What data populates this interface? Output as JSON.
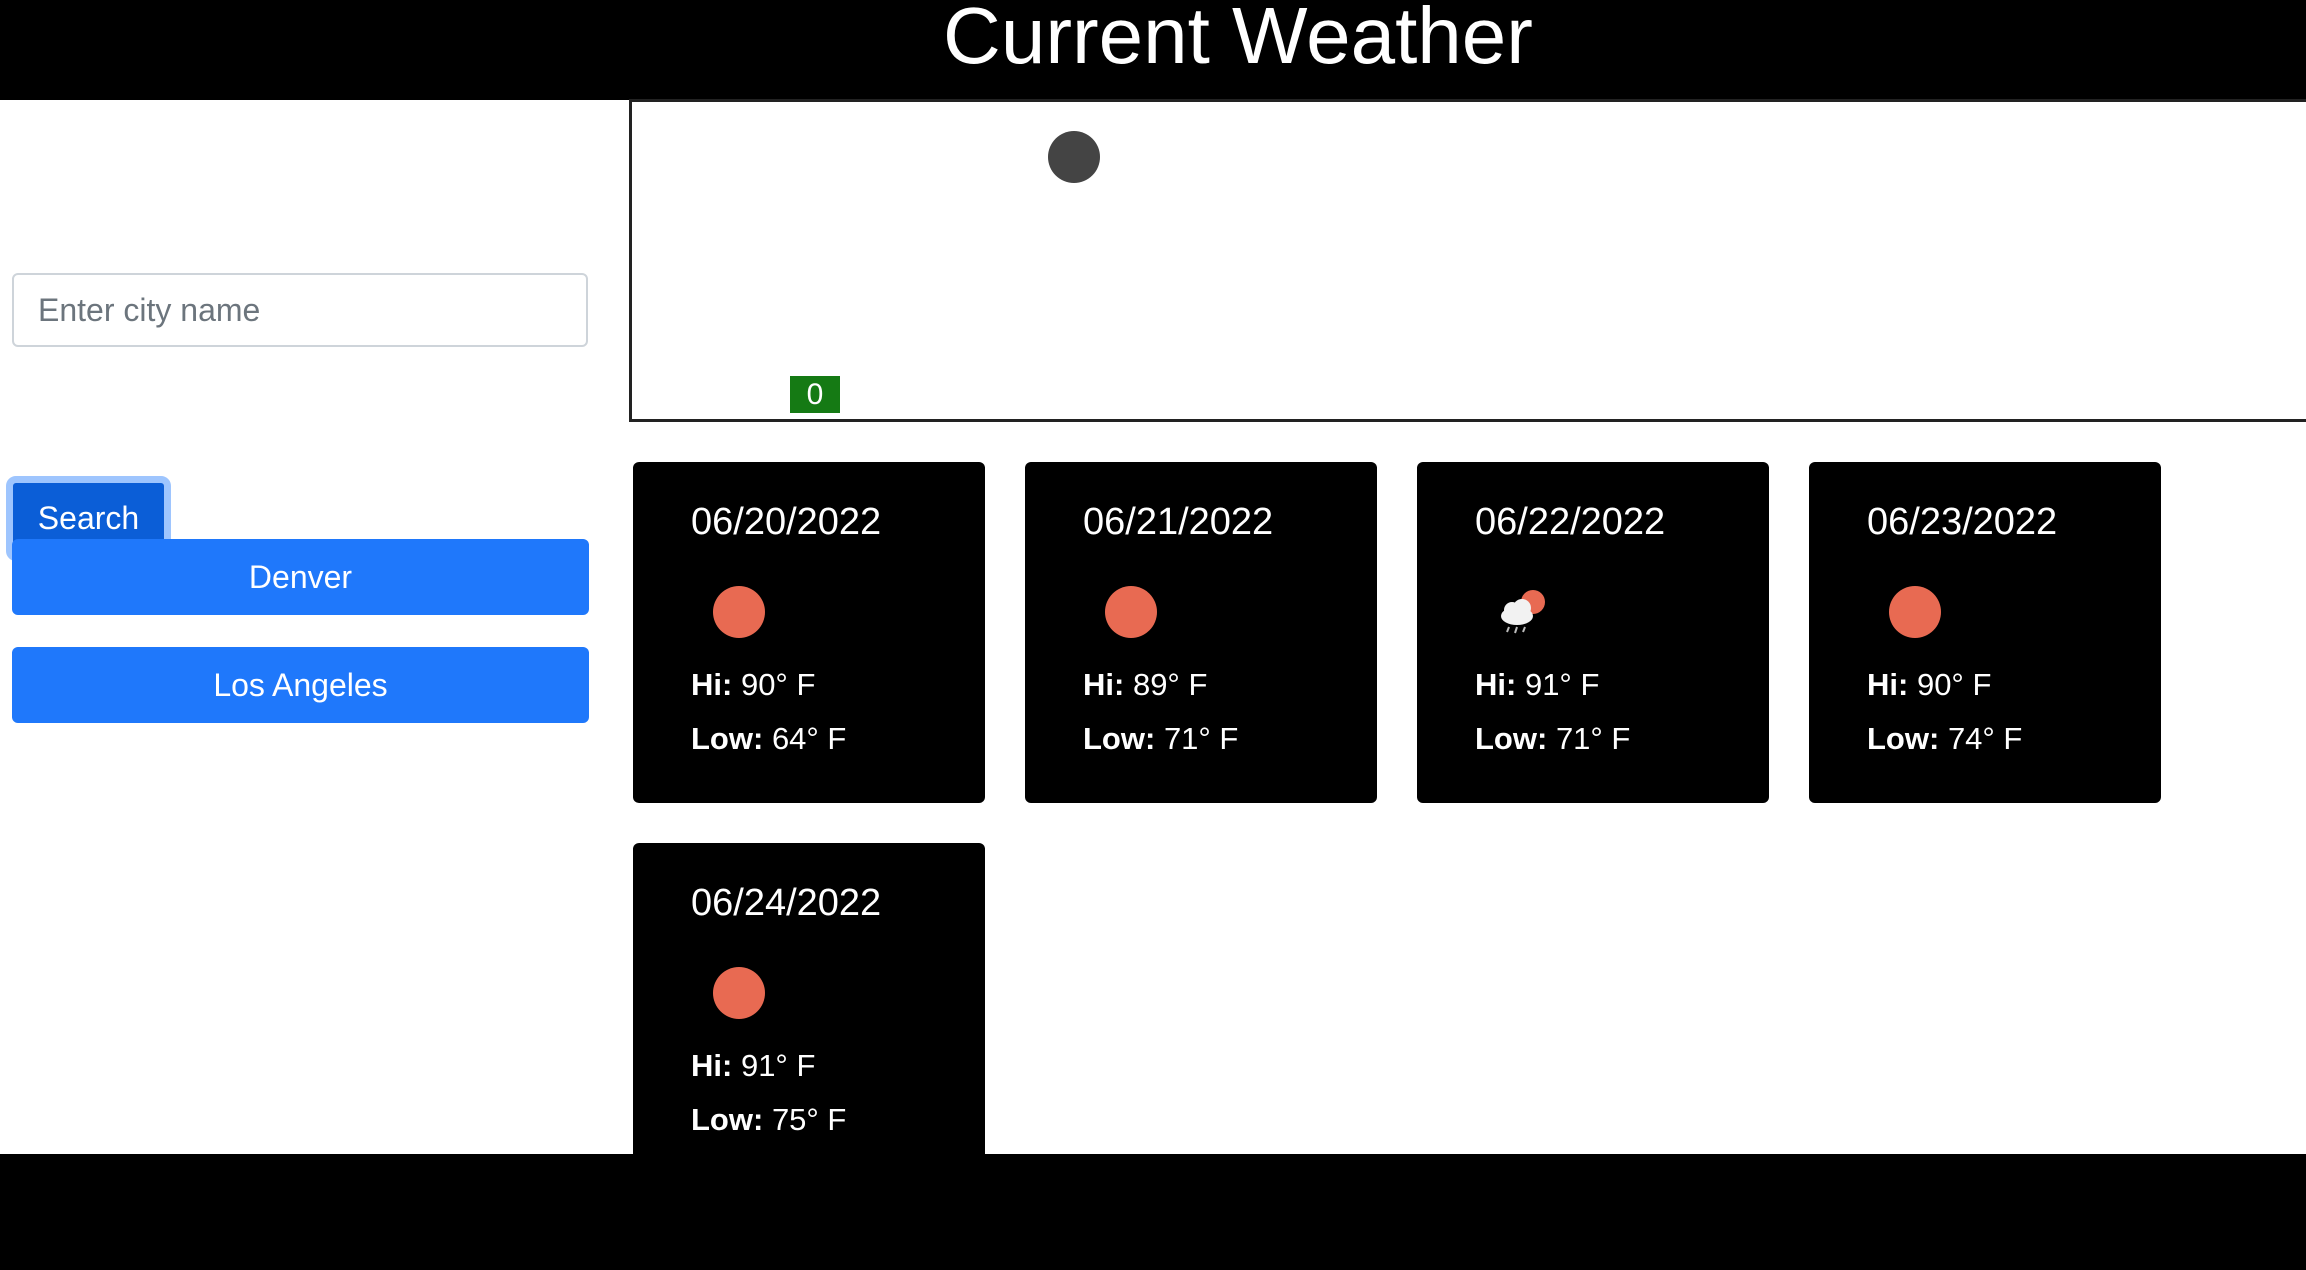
{
  "header": {
    "title": "Current Weather"
  },
  "search": {
    "placeholder": "Enter city name",
    "value": "",
    "button_label": "Search"
  },
  "history": {
    "items": [
      {
        "label": "Denver"
      },
      {
        "label": "Los Angeles"
      }
    ]
  },
  "current": {
    "icon": "weather-icon-placeholder",
    "uv_index": "0",
    "uv_color": "#157a14"
  },
  "forecast": [
    {
      "date": "06/20/2022",
      "icon": "sun-icon",
      "hi_label": "Hi:",
      "hi": "90° F",
      "low_label": "Low:",
      "low": "64° F"
    },
    {
      "date": "06/21/2022",
      "icon": "sun-icon",
      "hi_label": "Hi:",
      "hi": "89° F",
      "low_label": "Low:",
      "low": "71° F"
    },
    {
      "date": "06/22/2022",
      "icon": "rain-cloud-sun-icon",
      "hi_label": "Hi:",
      "hi": "91° F",
      "low_label": "Low:",
      "low": "71° F"
    },
    {
      "date": "06/23/2022",
      "icon": "sun-icon",
      "hi_label": "Hi:",
      "hi": "90° F",
      "low_label": "Low:",
      "low": "74° F"
    },
    {
      "date": "06/24/2022",
      "icon": "sun-icon",
      "hi_label": "Hi:",
      "hi": "91° F",
      "low_label": "Low:",
      "low": "75° F"
    }
  ],
  "colors": {
    "header_bg": "#000000",
    "button_primary": "#1f78fb",
    "button_focused": "#0b5ed7",
    "sun": "#e86a52",
    "uv_badge": "#157a14"
  }
}
